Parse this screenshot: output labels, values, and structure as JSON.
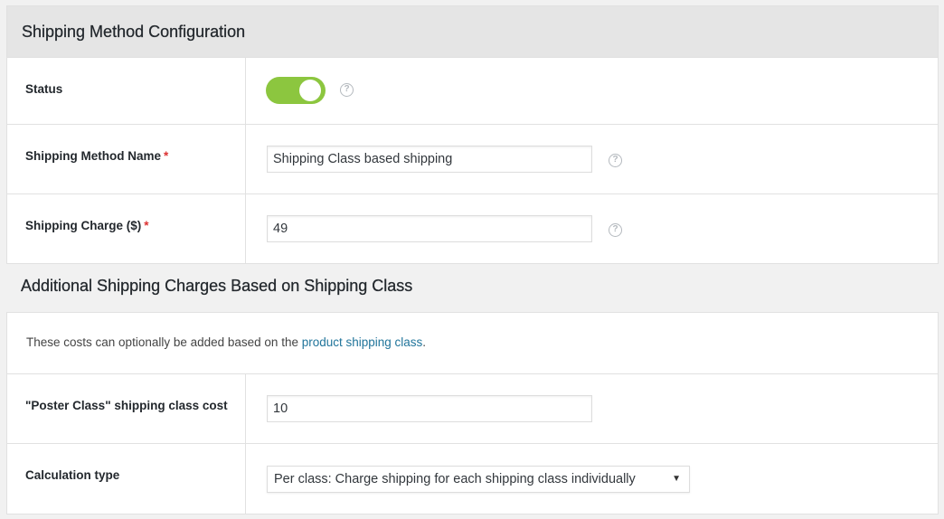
{
  "config": {
    "header_title": "Shipping Method Configuration",
    "status": {
      "label": "Status",
      "enabled": true
    },
    "method_name": {
      "label": "Shipping Method Name",
      "required_mark": "*",
      "value": "Shipping Class based shipping"
    },
    "charge": {
      "label": "Shipping Charge ($)",
      "required_mark": "*",
      "value": "49"
    },
    "help_glyph": "?"
  },
  "additional": {
    "heading": "Additional Shipping Charges Based on Shipping Class",
    "description_prefix": "These costs can optionally be added based on the ",
    "description_link": "product shipping class",
    "description_suffix": ".",
    "poster_class": {
      "label": "\"Poster Class\" shipping class cost",
      "value": "10"
    },
    "calc_type": {
      "label": "Calculation type",
      "selected": "Per class: Charge shipping for each shipping class individually",
      "arrow": "▼"
    }
  },
  "colors": {
    "toggle_on": "#8cc63f",
    "required": "#dc3232",
    "link": "#21759b"
  }
}
